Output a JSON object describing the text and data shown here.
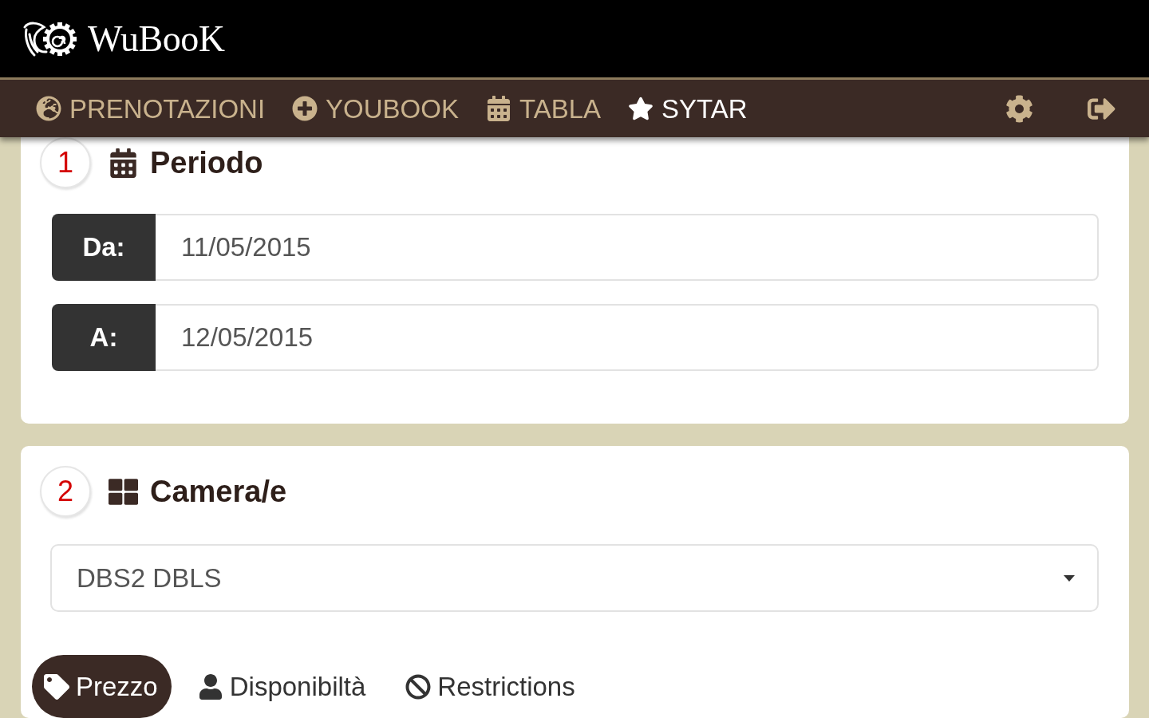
{
  "header": {
    "logo_text": "WuBooK"
  },
  "nav": {
    "items": [
      {
        "label": "PRENOTAZIONI",
        "selected": false
      },
      {
        "label": "YOUBOOK",
        "selected": false
      },
      {
        "label": "TABLA",
        "selected": false
      },
      {
        "label": "SYTAR",
        "selected": true
      }
    ]
  },
  "sections": [
    {
      "number": "1",
      "title": "Periodo",
      "fields": [
        {
          "label": "Da:",
          "value": "11/05/2015"
        },
        {
          "label": "A:",
          "value": "12/05/2015"
        }
      ]
    },
    {
      "number": "2",
      "title": "Camera/e",
      "select": {
        "value": "DBS2 DBLS"
      },
      "tabs": [
        {
          "label": "Prezzo",
          "selected": true
        },
        {
          "label": "Disponibiltà",
          "selected": false
        },
        {
          "label": "Restrictions",
          "selected": false
        }
      ]
    }
  ]
}
